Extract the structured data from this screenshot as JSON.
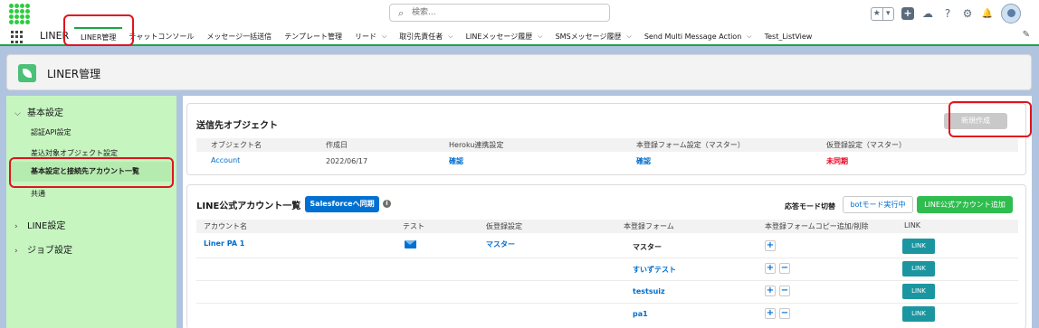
{
  "header": {
    "search_placeholder": "検索...",
    "fav_star": "★",
    "fav_dropdown": "▾",
    "add_icon": "+",
    "trailhead_icon": "☁",
    "help_icon": "?",
    "setup_icon": "⚙",
    "bell_icon": "🔔"
  },
  "nav": {
    "app_name": "LINER",
    "tabs": [
      {
        "label": "LINER管理",
        "chevron": false
      },
      {
        "label": "チャットコンソール",
        "chevron": false
      },
      {
        "label": "メッセージ一括送信",
        "chevron": false
      },
      {
        "label": "テンプレート管理",
        "chevron": false
      },
      {
        "label": "リード",
        "chevron": true
      },
      {
        "label": "取引先責任者",
        "chevron": true
      },
      {
        "label": "LINEメッセージ履歴",
        "chevron": true
      },
      {
        "label": "SMSメッセージ履歴",
        "chevron": true
      },
      {
        "label": "Send Multi Message Action",
        "chevron": true
      },
      {
        "label": "Test_ListView",
        "chevron": false
      }
    ],
    "edit_icon": "✎"
  },
  "page": {
    "title": "LINER管理"
  },
  "sidebar": {
    "sections": [
      {
        "label": "基本設定",
        "chevron": "⌵"
      },
      {
        "label": "LINE設定",
        "chevron": "›"
      },
      {
        "label": "ジョブ設定",
        "chevron": "›"
      }
    ],
    "items": [
      "認証API設定",
      "差込対象オブジェクト設定",
      "基本設定と接続先アカウント一覧",
      "共通"
    ]
  },
  "dest_objects": {
    "title": "送信先オブジェクト",
    "new_button": "新規作成",
    "columns": [
      "オブジェクト名",
      "作成日",
      "Heroku連携設定",
      "本登録フォーム設定（マスター）",
      "仮登録設定（マスター）"
    ],
    "row": {
      "object": "Account",
      "created": "2022/06/17",
      "heroku": "確認",
      "form": "確認",
      "temp": "未同期"
    }
  },
  "line_accounts": {
    "title": "LINE公式アカウント一覧",
    "sf_sync_button": "Salesforceへ同期",
    "info_icon": "i",
    "response_mode_label": "応答モード切替",
    "bot_mode_button": "botモード実行中",
    "add_account_button": "LINE公式アカウント追加",
    "columns": [
      "アカウント名",
      "テスト",
      "仮登録設定",
      "本登録フォーム",
      "本登録フォームコピー追加/削除",
      "LINK"
    ],
    "account_name": "Liner PA 1",
    "temp_setting": "マスター",
    "forms": [
      "マスター",
      "すいずテスト",
      "testsuiz",
      "pa1"
    ],
    "plus": "+",
    "minus": "−",
    "link_label": "LINK"
  }
}
